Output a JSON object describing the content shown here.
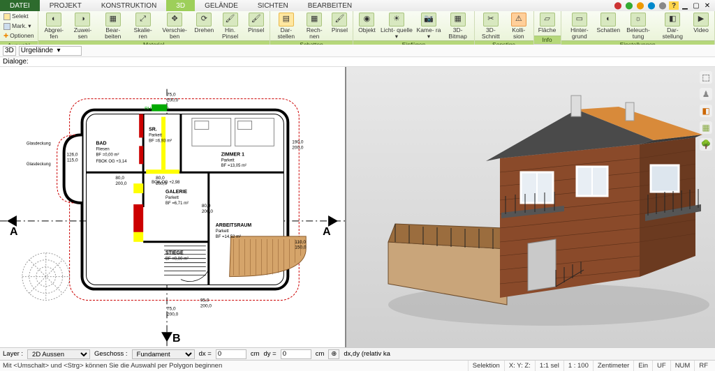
{
  "menu": {
    "tabs": [
      "DATEI",
      "PROJEKT",
      "KONSTRUKTION",
      "3D",
      "GELÄNDE",
      "SICHTEN",
      "BEARBEITEN"
    ],
    "active": "3D"
  },
  "ribbon": {
    "auswahl": {
      "selekt": "Selekt",
      "mark": "Mark.",
      "optionen": "Optionen",
      "label": "Auswahl"
    },
    "material": {
      "buttons": [
        "Abgrei-\nfen",
        "Zuwei-\nsen",
        "Bear-\nbeiten",
        "Skalie-\nren",
        "Verschie-\nben",
        "Drehen",
        "Hin.\nPinsel",
        "Pinsel"
      ],
      "label": "Material"
    },
    "schatten": {
      "buttons": [
        "Dar-\nstellen",
        "Rech-\nnen",
        "Pinsel"
      ],
      "label": "Schatten"
    },
    "einfuegen": {
      "buttons": [
        "Objekt",
        "Licht-\nquelle ▾",
        "Kame-\nra ▾",
        "3D-\nBitmap"
      ],
      "label": "Einfügen"
    },
    "sonstige": {
      "buttons": [
        "3D-\nSchnitt",
        "Kolli-\nsion"
      ],
      "label": "Sonstige"
    },
    "info": {
      "buttons": [
        "Fläche"
      ],
      "label": "Info"
    },
    "einstellungen": {
      "buttons": [
        "Hinter-\ngrund",
        "Schatten",
        "Beleuch-\ntung",
        "Dar-\nstellung",
        "Video"
      ],
      "label": "Einstellungen"
    }
  },
  "subbar": {
    "mode": "3D",
    "layer": "Urgelände"
  },
  "dialoge": "Dialoge:",
  "plan": {
    "rooms": {
      "bad": {
        "name": "BAD",
        "mat": "Fliesen",
        "bf": "BF =0,00 m²",
        "extra": "FBOK OG\n+3,14"
      },
      "sr": {
        "name": "SR.",
        "mat": "Parkett",
        "bf": "BF =6,93 m²"
      },
      "zimmer1": {
        "name": "ZIMMER 1",
        "mat": "Parkett",
        "bf": "BF =13,05 m²"
      },
      "galerie": {
        "name": "GALERIE",
        "mat": "Parkett",
        "bf": "BF =6,71 m²",
        "bok": "BOK OG\n+2,98"
      },
      "arbeitsraum": {
        "name": "ARBEITSRAUM",
        "mat": "Parkett",
        "bf": "BF =14,52 m²"
      },
      "stiege": {
        "name": "STIEGE",
        "bf": "BF =0,00 m²"
      },
      "glas1": "Glasdeckung",
      "glas2": "Glasdeckung"
    },
    "dims": {
      "d1": "126,0",
      "d2": "115,0",
      "d3": "80,0",
      "d4": "200,0",
      "d5": "80,0",
      "d6": "200,0",
      "d7": "80,0",
      "d8": "200,0",
      "d9": "190,0",
      "d10": "200,0",
      "d11": "75,0",
      "d12": "200,0",
      "d13": "95,0",
      "d14": "200,0",
      "d15": "110,0",
      "d16": "150,0",
      "d17": "75,0",
      "d18": "200,0",
      "d19": "RH15 105,0"
    },
    "sections": {
      "left": "A",
      "right": "A",
      "bottom": "B"
    }
  },
  "coordbar": {
    "layer_lbl": "Layer :",
    "layer_val": "2D Aussen",
    "geschoss_lbl": "Geschoss :",
    "geschoss_val": "Fundament",
    "dx_lbl": "dx =",
    "dx_val": "0",
    "dy_lbl": "dy =",
    "dy_val": "0",
    "unit": "cm",
    "note": "dx,dy (relativ ka"
  },
  "status": {
    "hint": "Mit <Umschalt> und <Strg> können Sie die Auswahl per Polygon beginnen",
    "selektion": "Selektion",
    "xyz": "X:                 Y:                 Z:",
    "sel": "1:1 sel",
    "scale": "1 : 100",
    "unit": "Zentimeter",
    "ein": "Ein",
    "uf": "UF",
    "num": "NUM",
    "rf": "RF"
  }
}
